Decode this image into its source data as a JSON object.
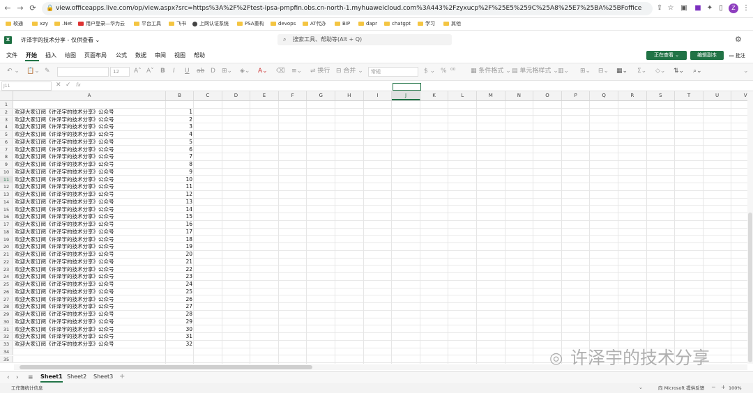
{
  "browser": {
    "url": "view.officeapps.live.com/op/view.aspx?src=https%3A%2F%2Ftest-ipsa-pmpfin.obs.cn-north-1.myhuaweicloud.com%3A443%2Fzyxucp%2F%25E5%259C%25A8%25E7%25BA%25BFoffice%2F%25E8%25AE%25B8%25E6%25B...",
    "profile_initial": "Z"
  },
  "bookmarks": [
    "软通",
    "xzy",
    ".Net",
    "用户登录—华为云",
    "平台工具",
    "飞书",
    "上网认证系统",
    "PSA重构",
    "devops",
    "AT代办",
    "BIP",
    "dapr",
    "chatgpt",
    "学习",
    "其他"
  ],
  "app": {
    "logo": "X",
    "doc_title": "许泽宇的技术分享 - 仅供查看 ⌄",
    "search_placeholder": "搜索工具、帮助等(Alt + Q)"
  },
  "ribbon": {
    "tabs": [
      "文件",
      "开始",
      "插入",
      "绘图",
      "页面布局",
      "公式",
      "数据",
      "审阅",
      "视图",
      "帮助"
    ],
    "active_tab": "开始",
    "view_button": "正在查看 ⌄",
    "edit_copy_button": "编辑副本",
    "comment_button": "批注"
  },
  "toolbar": {
    "font_size": "12",
    "wrap_text": "换行",
    "merge": "合并",
    "number_format": "常规",
    "conditional_format": "条件格式",
    "cell_styles": "单元格样式"
  },
  "formula_bar": {
    "name_box": "J11",
    "fx": "fx"
  },
  "grid": {
    "columns": [
      "A",
      "B",
      "C",
      "D",
      "E",
      "F",
      "G",
      "H",
      "I",
      "J",
      "K",
      "L",
      "M",
      "N",
      "O",
      "P",
      "Q",
      "R",
      "S",
      "T",
      "U",
      "V"
    ],
    "selected_column": "J",
    "selected_row": 11,
    "row_numbers": [
      "1",
      "2",
      "3",
      "4",
      "5",
      "6",
      "7",
      "8",
      "9",
      "10",
      "11",
      "12",
      "13",
      "14",
      "15",
      "16",
      "17",
      "18",
      "19",
      "20",
      "21",
      "22",
      "23",
      "24",
      "25",
      "26",
      "27",
      "28",
      "29",
      "30",
      "31",
      "32",
      "33",
      "34",
      "35"
    ],
    "cell_text": "欢迎大家订阅《许泽宇的技术分享》公众号",
    "values": [
      "1",
      "2",
      "3",
      "4",
      "5",
      "6",
      "7",
      "8",
      "9",
      "10",
      "11",
      "12",
      "13",
      "14",
      "15",
      "16",
      "17",
      "18",
      "19",
      "20",
      "21",
      "22",
      "23",
      "24",
      "25",
      "26",
      "27",
      "28",
      "29",
      "30",
      "31",
      "32"
    ]
  },
  "sheets": [
    "Sheet1",
    "Sheet2",
    "Sheet3"
  ],
  "active_sheet": "Sheet1",
  "status": {
    "left": "工作簿统计信息",
    "right": "向 Microsoft 提供反馈",
    "zoom": "100%"
  },
  "watermark": "许泽宇的技术分享",
  "colors": {
    "accent": "#217346"
  }
}
